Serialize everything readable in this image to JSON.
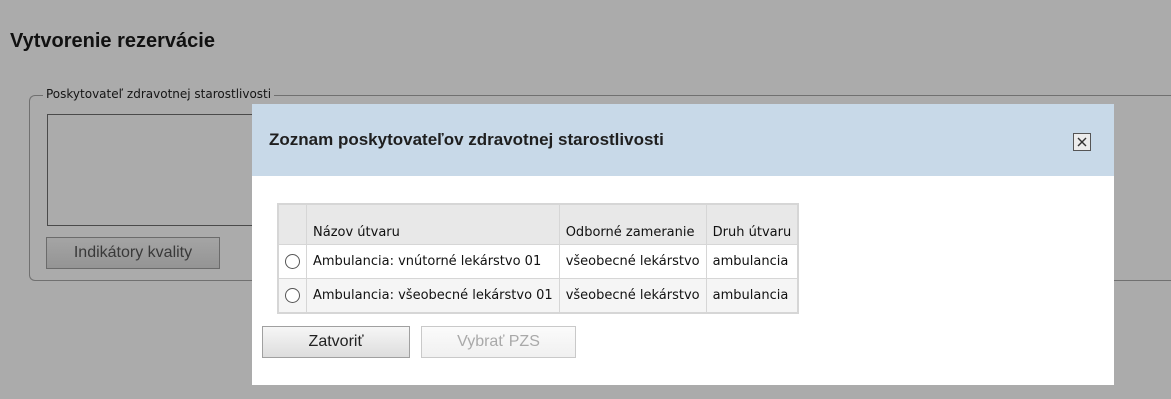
{
  "page": {
    "title": "Vytvorenie rezervácie",
    "fieldset_legend": "Poskytovateľ zdravotnej starostlivosti",
    "quality_button_label": "Indikátory kvality"
  },
  "modal": {
    "title": "Zoznam poskytovateľov zdravotnej starostlivosti",
    "close_icon": "close-icon",
    "table": {
      "columns": [
        "Názov útvaru",
        "Odborné zameranie",
        "Druh útvaru"
      ],
      "rows": [
        {
          "selected": false,
          "name": "Ambulancia: vnútorné lekárstvo 01",
          "specialization": "všeobecné lekárstvo",
          "type": "ambulancia"
        },
        {
          "selected": false,
          "name": "Ambulancia: všeobecné lekárstvo 01",
          "specialization": "všeobecné lekárstvo",
          "type": "ambulancia"
        }
      ]
    },
    "close_button_label": "Zatvoriť",
    "select_button_label": "Vybrať PZS"
  },
  "colors": {
    "modal_header_bg": "#c8d9e8",
    "overlay": "rgba(0,0,0,0.33)"
  }
}
